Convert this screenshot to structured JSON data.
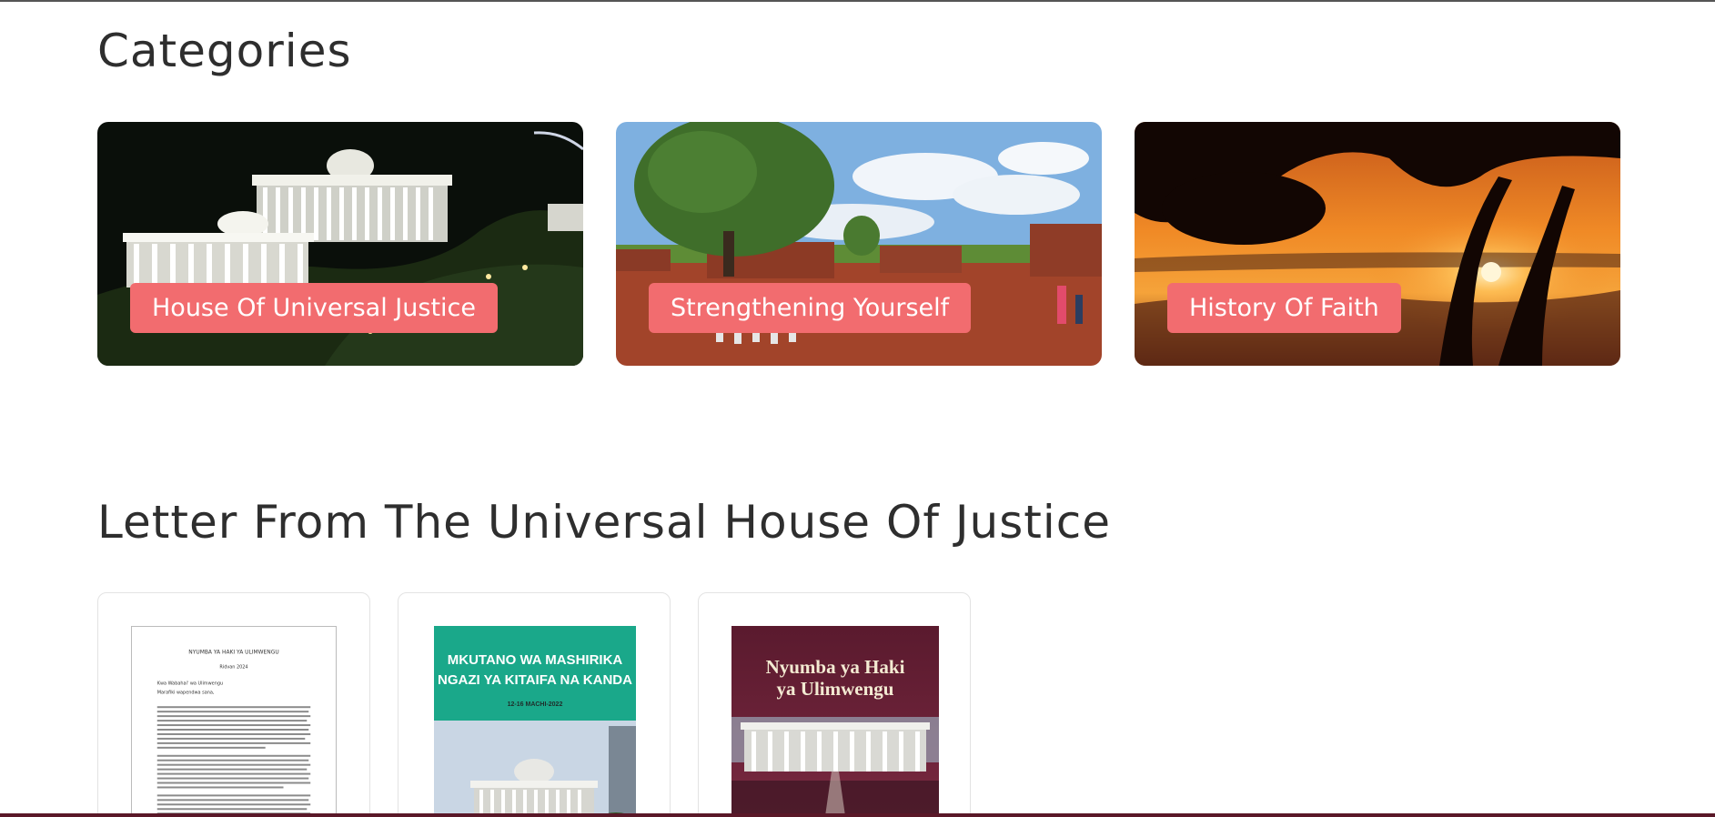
{
  "sections": {
    "categories_title": "Categories",
    "letters_title": "Letter From The Universal House Of Justice"
  },
  "categories": [
    {
      "label": "House Of Universal Justice"
    },
    {
      "label": "Strengthening Yourself"
    },
    {
      "label": "History Of Faith"
    }
  ],
  "documents": [
    {
      "heading": "NYUMBA YA HAKI YA ULIMWENGU",
      "date": "Ridvan 2024",
      "salutation": "Kwa Wabahai' wa Ulimwengu",
      "subsalutation": "Marafiki wapendwa sana,"
    },
    {
      "title_line1": "MKUTANO WA MASHIRIKA",
      "title_line2": "NGAZI YA KITAIFA NA KANDA",
      "date": "12-16 MACHI-2022"
    },
    {
      "title_line1": "Nyumba ya Haki",
      "title_line2": "ya Ulimwengu"
    }
  ],
  "colors": {
    "label_bg": "#f26c6f",
    "doc2_banner": "#1aa88a",
    "doc3_bg": "#6b2238"
  }
}
